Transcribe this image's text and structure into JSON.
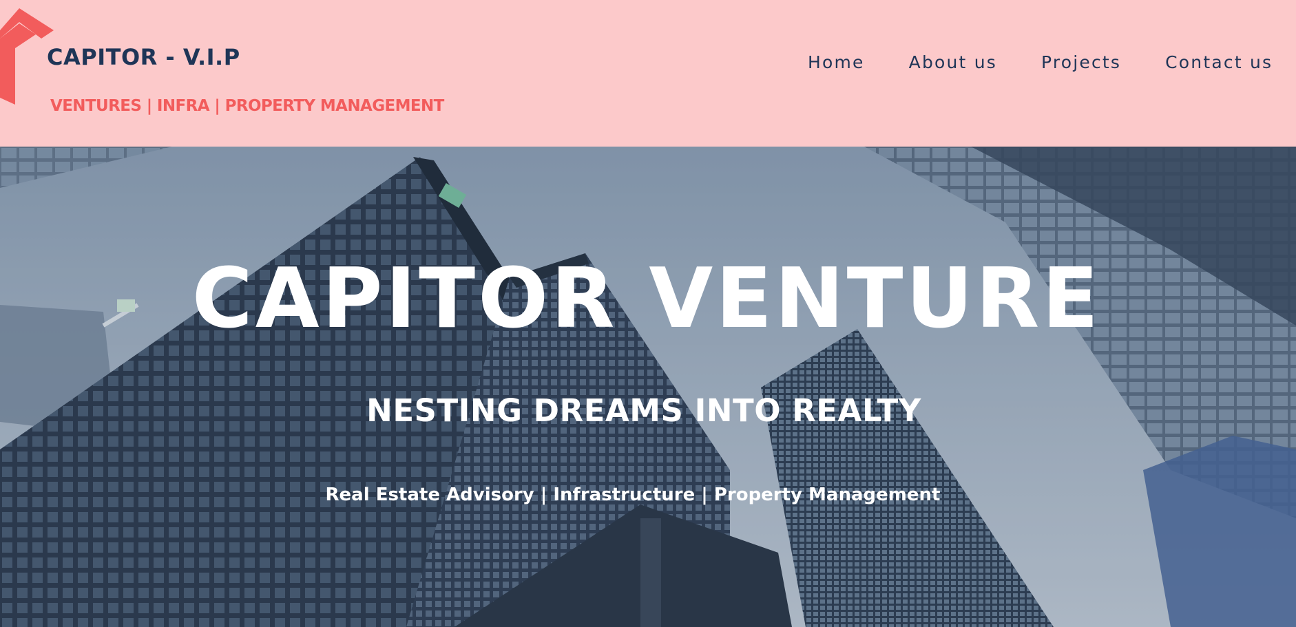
{
  "header": {
    "brand_name": "CAPITOR - V.I.P",
    "tagline": "VENTURES | INFRA | PROPERTY MANAGEMENT",
    "logo_icon": "house-roof-logo-icon"
  },
  "nav": {
    "items": [
      {
        "label": "Home"
      },
      {
        "label": "About us"
      },
      {
        "label": "Projects"
      },
      {
        "label": "Contact us"
      }
    ]
  },
  "hero": {
    "title": "CAPITOR VENTURE",
    "subtitle": "NESTING DREAMS INTO REALTY",
    "services": "Real Estate Advisory | Infrastructure | Property Management"
  },
  "colors": {
    "header_bg": "#fcc9ca",
    "brand_navy": "#1f3557",
    "brand_red": "#f25c5c",
    "hero_text": "#ffffff"
  }
}
